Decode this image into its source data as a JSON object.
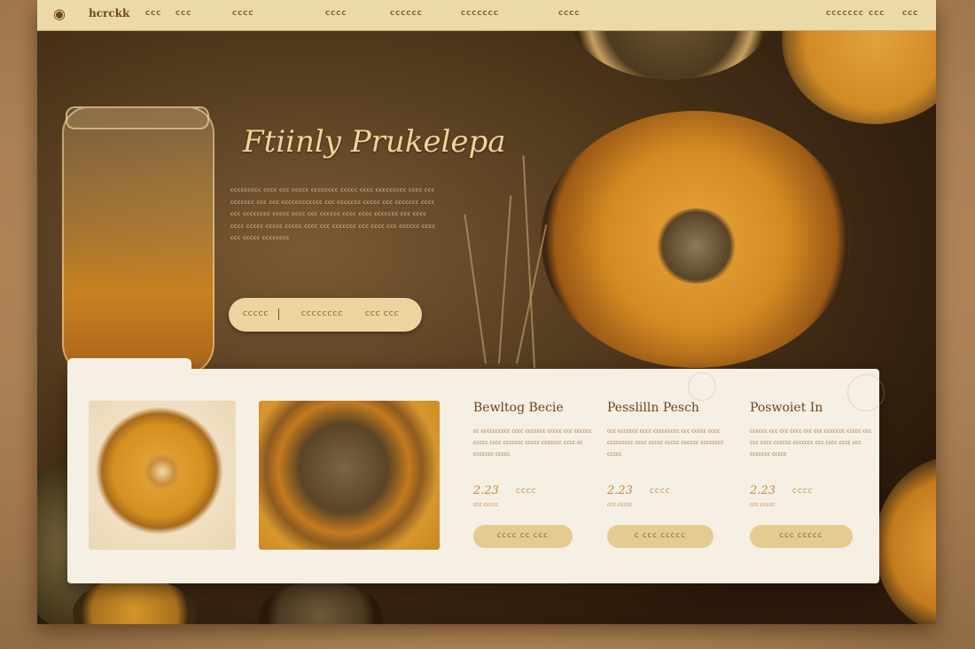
{
  "nav": {
    "brand": "hcrckk",
    "links": [
      "CCC",
      "CCC",
      "CCCC",
      "CCCC",
      "CCCCCC",
      "CCCCCCC",
      "CCCC"
    ],
    "right_links": [
      "CCCCCCC",
      "CCC",
      "CCC"
    ]
  },
  "hero": {
    "title": "Ftiinly Prukelepa",
    "body": "ccccccccc cccc ccc ccccc cccccccc ccccc cccc ccccccccc cccc ccc ccccccc ccc ccc cccccccccccc ccc ccccccc ccccc ccc ccccccc cccc ccc cccccccc ccccc cccc ccc cccccc cccc cccc ccccccc ccc cccc cccc ccccc ccccc ccccc cccc ccc ccccccc ccc cccc ccc cccccc cccc ccc ccccc cccccccc",
    "cta_left": "CCCCC",
    "cta_mid": "CCCCCCCC",
    "cta_right": "CCC CCC"
  },
  "products": [
    {
      "name": "Bewltog Becie",
      "desc": "cc cccccccccc cccc ccccccc ccccc ccc cccccc ccccc cccc ccccccc ccccc ccccccc cccc cc ccccccc ccccc",
      "price": "2.23",
      "unit": "CCCC",
      "sub": "ccc ccccc",
      "button": "CCCC CC CCC"
    },
    {
      "name": "Pesslilln Pesch",
      "desc": "ccc ccccccc cccc ccccccccc ccc ccccc cccc ccccccccc cccc ccccc ccccc cccccc cccccccc ccccc",
      "price": "2.23",
      "unit": "CCCC",
      "sub": "ccc ccccc",
      "button": "C CCC CCCCC"
    },
    {
      "name": "Poswoiet In",
      "desc": "cccccc ccc ccc cccc ccc ccc ccccccc ccccc ccc ccc cccc cccccc ccccccc ccc cccc cccc ccc ccccccc ccccc",
      "price": "2.23",
      "unit": "CCCC",
      "sub": "ccc ccccc",
      "button": "CCC CCCCC"
    }
  ],
  "colors": {
    "accent": "#ecd3a0",
    "title": "#f2d49a",
    "panel": "#f6efe4",
    "text_brown": "#6b4418"
  },
  "icons": {
    "logo": "pot-logo-icon"
  }
}
